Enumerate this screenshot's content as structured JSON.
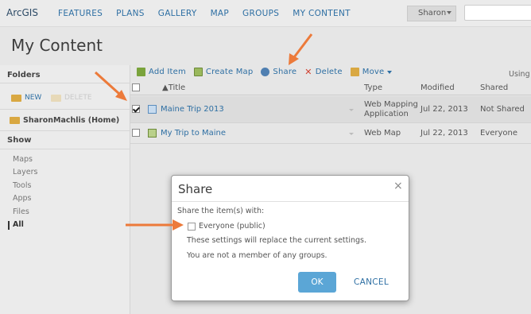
{
  "colors": {
    "link": "#2e6fa3",
    "accent": "#5ba6d6",
    "annotation_arrow": "#ec7a3a"
  },
  "topnav": {
    "logo": "ArcGIS",
    "links": [
      "FEATURES",
      "PLANS",
      "GALLERY",
      "MAP",
      "GROUPS",
      "MY CONTENT"
    ],
    "user": "Sharon"
  },
  "page_title": "My Content",
  "sidebar": {
    "folders_heading": "Folders",
    "new_label": "NEW",
    "delete_label": "DELETE",
    "home_folder": "SharonMachlis (Home)",
    "show_heading": "Show",
    "show_items": [
      "Maps",
      "Layers",
      "Tools",
      "Apps",
      "Files",
      "All"
    ]
  },
  "toolbar": {
    "add_item": "Add Item",
    "create_map": "Create Map",
    "share": "Share",
    "delete": "Delete",
    "move": "Move",
    "using": "Using"
  },
  "table": {
    "columns": {
      "title": "▲Title",
      "type": "Type",
      "modified": "Modified",
      "shared": "Shared"
    },
    "rows": [
      {
        "title": "Maine Trip 2013",
        "type_line1": "Web Mapping",
        "type_line2": "Application",
        "modified": "Jul 22, 2013",
        "shared": "Not Shared",
        "checked": true
      },
      {
        "title": "My Trip to Maine",
        "type_line1": "Web Map",
        "type_line2": "",
        "modified": "Jul 22, 2013",
        "shared": "Everyone",
        "checked": false
      }
    ]
  },
  "dialog": {
    "title": "Share",
    "close_glyph": "×",
    "prompt": "Share the item(s) with:",
    "everyone_label": "Everyone (public)",
    "note1": "These settings will replace the current settings.",
    "note2": "You are not a member of any groups.",
    "ok": "OK",
    "cancel": "CANCEL"
  }
}
